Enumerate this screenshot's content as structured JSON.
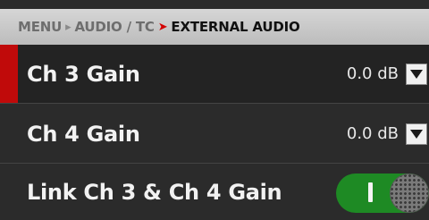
{
  "breadcrumb": {
    "items": [
      "MENU",
      "AUDIO / TC"
    ],
    "current": "EXTERNAL AUDIO"
  },
  "rows": [
    {
      "label": "Ch 3 Gain",
      "value": "0.0 dB",
      "selected": true
    },
    {
      "label": "Ch 4 Gain",
      "value": "0.0 dB",
      "selected": false
    },
    {
      "label": "Link Ch 3 & Ch 4 Gain",
      "toggle_state": "on"
    }
  ],
  "colors": {
    "accent_red": "#c00a0a",
    "toggle_on": "#1e8a24"
  },
  "icons": [
    "chevron-down-icon",
    "chevron-right-icon"
  ]
}
